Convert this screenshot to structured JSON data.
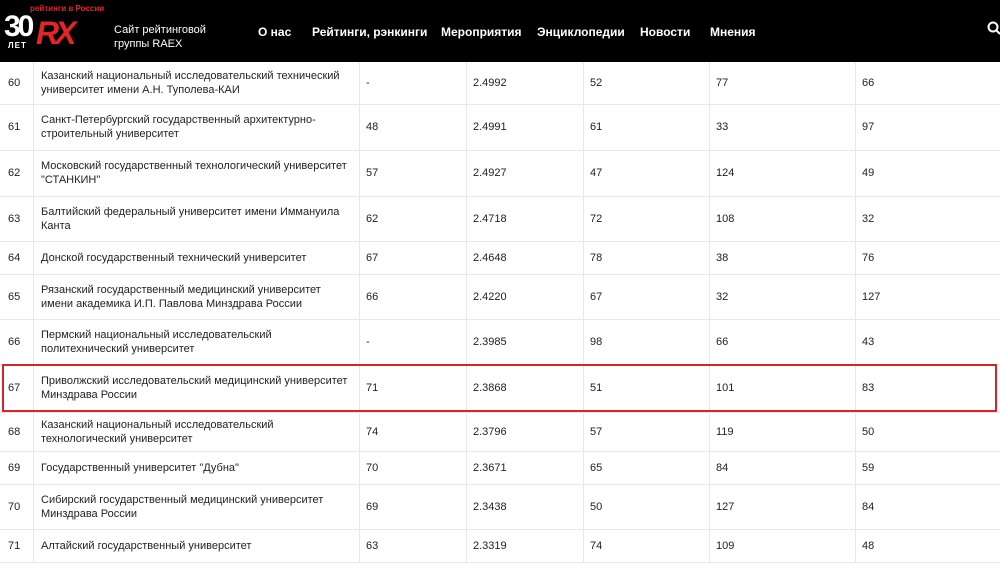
{
  "header": {
    "logo": {
      "years": "30",
      "years_suffix": "ЛЕТ",
      "brand": "RX",
      "tagline": "рейтинги в России"
    },
    "site_description": "Сайт рейтинговой группы RAEX",
    "nav": [
      "О нас",
      "Рейтинги, рэнкинги",
      "Мероприятия",
      "Энциклопедии",
      "Новости",
      "Мнения"
    ],
    "search_icon": "search-icon"
  },
  "highlight_color": "#d8232a",
  "rows": [
    {
      "rank": "60",
      "name": "Казанский национальный исследовательский технический университет имени А.Н. Туполева-КАИ",
      "v1": "-",
      "v2": "2.4992",
      "v3": "52",
      "v4": "77",
      "v5": "66"
    },
    {
      "rank": "61",
      "name": "Санкт-Петербургский государственный архитектурно-строительный университет",
      "v1": "48",
      "v2": "2.4991",
      "v3": "61",
      "v4": "33",
      "v5": "97"
    },
    {
      "rank": "62",
      "name": "Московский государственный технологический университет \"СТАНКИН\"",
      "v1": "57",
      "v2": "2.4927",
      "v3": "47",
      "v4": "124",
      "v5": "49"
    },
    {
      "rank": "63",
      "name": "Балтийский федеральный университет имени Иммануила Канта",
      "v1": "62",
      "v2": "2.4718",
      "v3": "72",
      "v4": "108",
      "v5": "32"
    },
    {
      "rank": "64",
      "name": "Донской государственный технический университет",
      "v1": "67",
      "v2": "2.4648",
      "v3": "78",
      "v4": "38",
      "v5": "76"
    },
    {
      "rank": "65",
      "name": "Рязанский государственный медицинский университет имени академика И.П. Павлова Минздрава России",
      "v1": "66",
      "v2": "2.4220",
      "v3": "67",
      "v4": "32",
      "v5": "127"
    },
    {
      "rank": "66",
      "name": "Пермский национальный исследовательский политехнический университет",
      "v1": "-",
      "v2": "2.3985",
      "v3": "98",
      "v4": "66",
      "v5": "43"
    },
    {
      "rank": "67",
      "name": "Приволжский исследовательский медицинский университет Минздрава России",
      "v1": "71",
      "v2": "2.3868",
      "v3": "51",
      "v4": "101",
      "v5": "83"
    },
    {
      "rank": "68",
      "name": "Казанский национальный исследовательский технологический университет",
      "v1": "74",
      "v2": "2.3796",
      "v3": "57",
      "v4": "119",
      "v5": "50"
    },
    {
      "rank": "69",
      "name": "Государственный университет \"Дубна\"",
      "v1": "70",
      "v2": "2.3671",
      "v3": "65",
      "v4": "84",
      "v5": "59"
    },
    {
      "rank": "70",
      "name": "Сибирский государственный медицинский университет Минздрава России",
      "v1": "69",
      "v2": "2.3438",
      "v3": "50",
      "v4": "127",
      "v5": "84"
    },
    {
      "rank": "71",
      "name": "Алтайский государственный университет",
      "v1": "63",
      "v2": "2.3319",
      "v3": "74",
      "v4": "109",
      "v5": "48"
    }
  ]
}
